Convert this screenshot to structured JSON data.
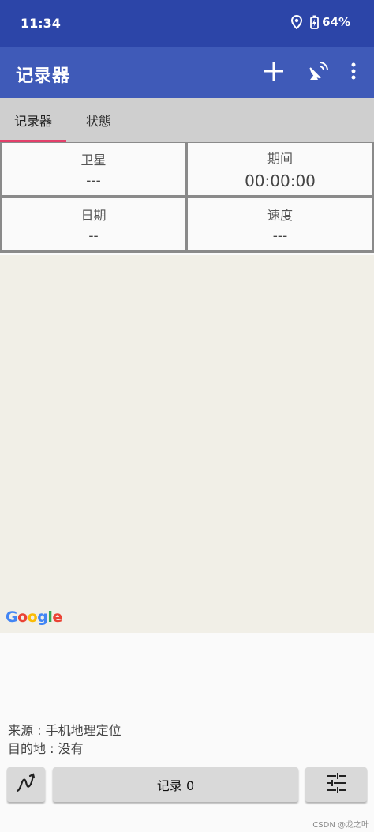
{
  "status_bar": {
    "time": "11:34",
    "battery": "64%",
    "icons": [
      "location-icon",
      "battery-charging-icon"
    ]
  },
  "app_bar": {
    "title": "记录器",
    "actions": [
      "add-icon",
      "satellite-dish-icon",
      "more-vert-icon"
    ]
  },
  "tabs": [
    {
      "label": "记录器",
      "selected": true
    },
    {
      "label": "状態",
      "selected": false
    }
  ],
  "stats": {
    "satellite": {
      "label": "卫星",
      "value": "---"
    },
    "duration": {
      "label": "期间",
      "value": "00:00:00"
    },
    "date": {
      "label": "日期",
      "value": "--"
    },
    "speed": {
      "label": "速度",
      "value": "---"
    }
  },
  "map": {
    "logo": "Google",
    "background": "#f1efe7"
  },
  "info": {
    "source": "来源 : 手机地理定位",
    "destination": "目的地 : 没有"
  },
  "bottom": {
    "record_label": "记录 0"
  },
  "watermark": "CSDN @龙之叶",
  "colors": {
    "status_bar": "#2c45a8",
    "app_bar": "#3f5ab8",
    "tab_indicator": "#e2406a"
  }
}
